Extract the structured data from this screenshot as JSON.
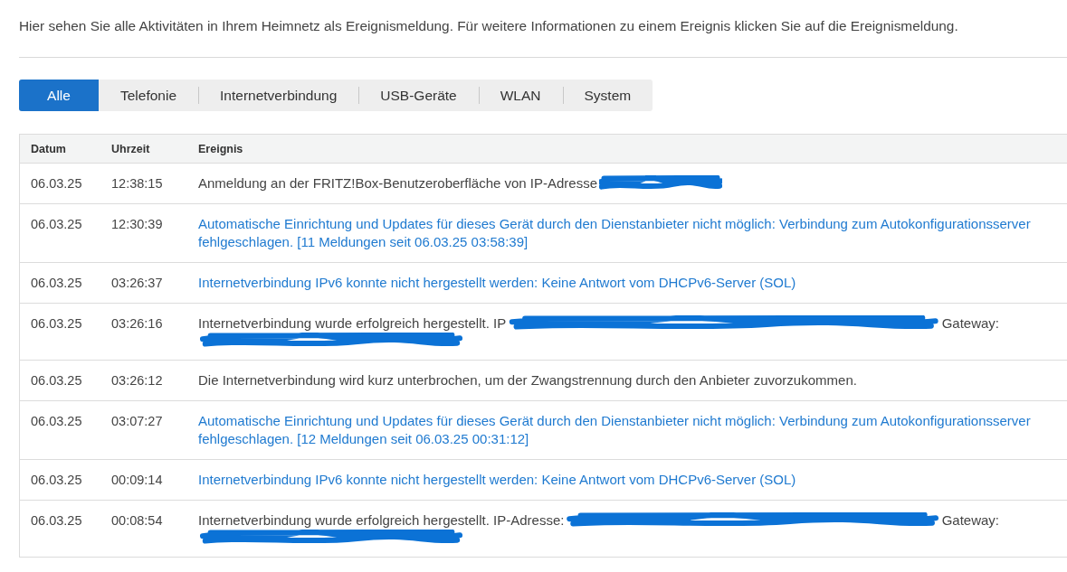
{
  "intro": "Hier sehen Sie alle Aktivitäten in Ihrem Heimnetz als Ereignismeldung. Für weitere Informationen zu einem Ereignis klicken Sie auf die Ereignismeldung.",
  "tabs": [
    {
      "label": "Alle",
      "selected": true
    },
    {
      "label": "Telefonie",
      "selected": false
    },
    {
      "label": "Internetverbindung",
      "selected": false
    },
    {
      "label": "USB-Geräte",
      "selected": false
    },
    {
      "label": "WLAN",
      "selected": false
    },
    {
      "label": "System",
      "selected": false
    }
  ],
  "table": {
    "columns": [
      "Datum",
      "Uhrzeit",
      "Ereignis"
    ],
    "rows": [
      {
        "date": "06.03.25",
        "time": "12:38:15",
        "event": {
          "link": false,
          "lines": [
            [
              {
                "kind": "text",
                "text": "Anmeldung an der FRITZ!Box-Benutzeroberfläche von IP-Adresse"
              },
              {
                "kind": "redacted"
              }
            ]
          ]
        }
      },
      {
        "date": "06.03.25",
        "time": "12:30:39",
        "event": {
          "link": true,
          "lines": [
            [
              {
                "kind": "text",
                "text": "Automatische Einrichtung und Updates für dieses Gerät durch den Dienstanbieter nicht möglich: Verbindung zum Autokonfigurationsserver fehlgeschlagen. [11 Meldungen seit 06.03.25 03:58:39]"
              }
            ]
          ]
        }
      },
      {
        "date": "06.03.25",
        "time": "03:26:37",
        "event": {
          "link": true,
          "lines": [
            [
              {
                "kind": "text",
                "text": "Internetverbindung IPv6 konnte nicht hergestellt werden: Keine Antwort vom DHCPv6-Server (SOL)"
              }
            ]
          ]
        }
      },
      {
        "date": "06.03.25",
        "time": "03:26:16",
        "event": {
          "link": false,
          "lines": [
            [
              {
                "kind": "text",
                "text": "Internetverbindung wurde erfolgreich hergestellt. IP"
              },
              {
                "kind": "redacted"
              },
              {
                "kind": "text",
                "text": "Gateway:"
              }
            ],
            [
              {
                "kind": "redacted"
              }
            ]
          ]
        }
      },
      {
        "date": "06.03.25",
        "time": "03:26:12",
        "event": {
          "link": false,
          "lines": [
            [
              {
                "kind": "text",
                "text": "Die Internetverbindung wird kurz unterbrochen, um der Zwangstrennung durch den Anbieter zuvorzukommen."
              }
            ]
          ]
        }
      },
      {
        "date": "06.03.25",
        "time": "03:07:27",
        "event": {
          "link": true,
          "lines": [
            [
              {
                "kind": "text",
                "text": "Automatische Einrichtung und Updates für dieses Gerät durch den Dienstanbieter nicht möglich: Verbindung zum Autokonfigurationsserver fehlgeschlagen. [12 Meldungen seit 06.03.25 00:31:12]"
              }
            ]
          ]
        }
      },
      {
        "date": "06.03.25",
        "time": "00:09:14",
        "event": {
          "link": true,
          "lines": [
            [
              {
                "kind": "text",
                "text": "Internetverbindung IPv6 konnte nicht hergestellt werden: Keine Antwort vom DHCPv6-Server (SOL)"
              }
            ]
          ]
        }
      },
      {
        "date": "06.03.25",
        "time": "00:08:54",
        "event": {
          "link": false,
          "lines": [
            [
              {
                "kind": "text",
                "text": "Internetverbindung wurde erfolgreich hergestellt. IP-Adresse:"
              },
              {
                "kind": "redacted"
              },
              {
                "kind": "text",
                "text": "Gateway:"
              }
            ],
            [
              {
                "kind": "redacted"
              }
            ]
          ]
        }
      }
    ]
  }
}
